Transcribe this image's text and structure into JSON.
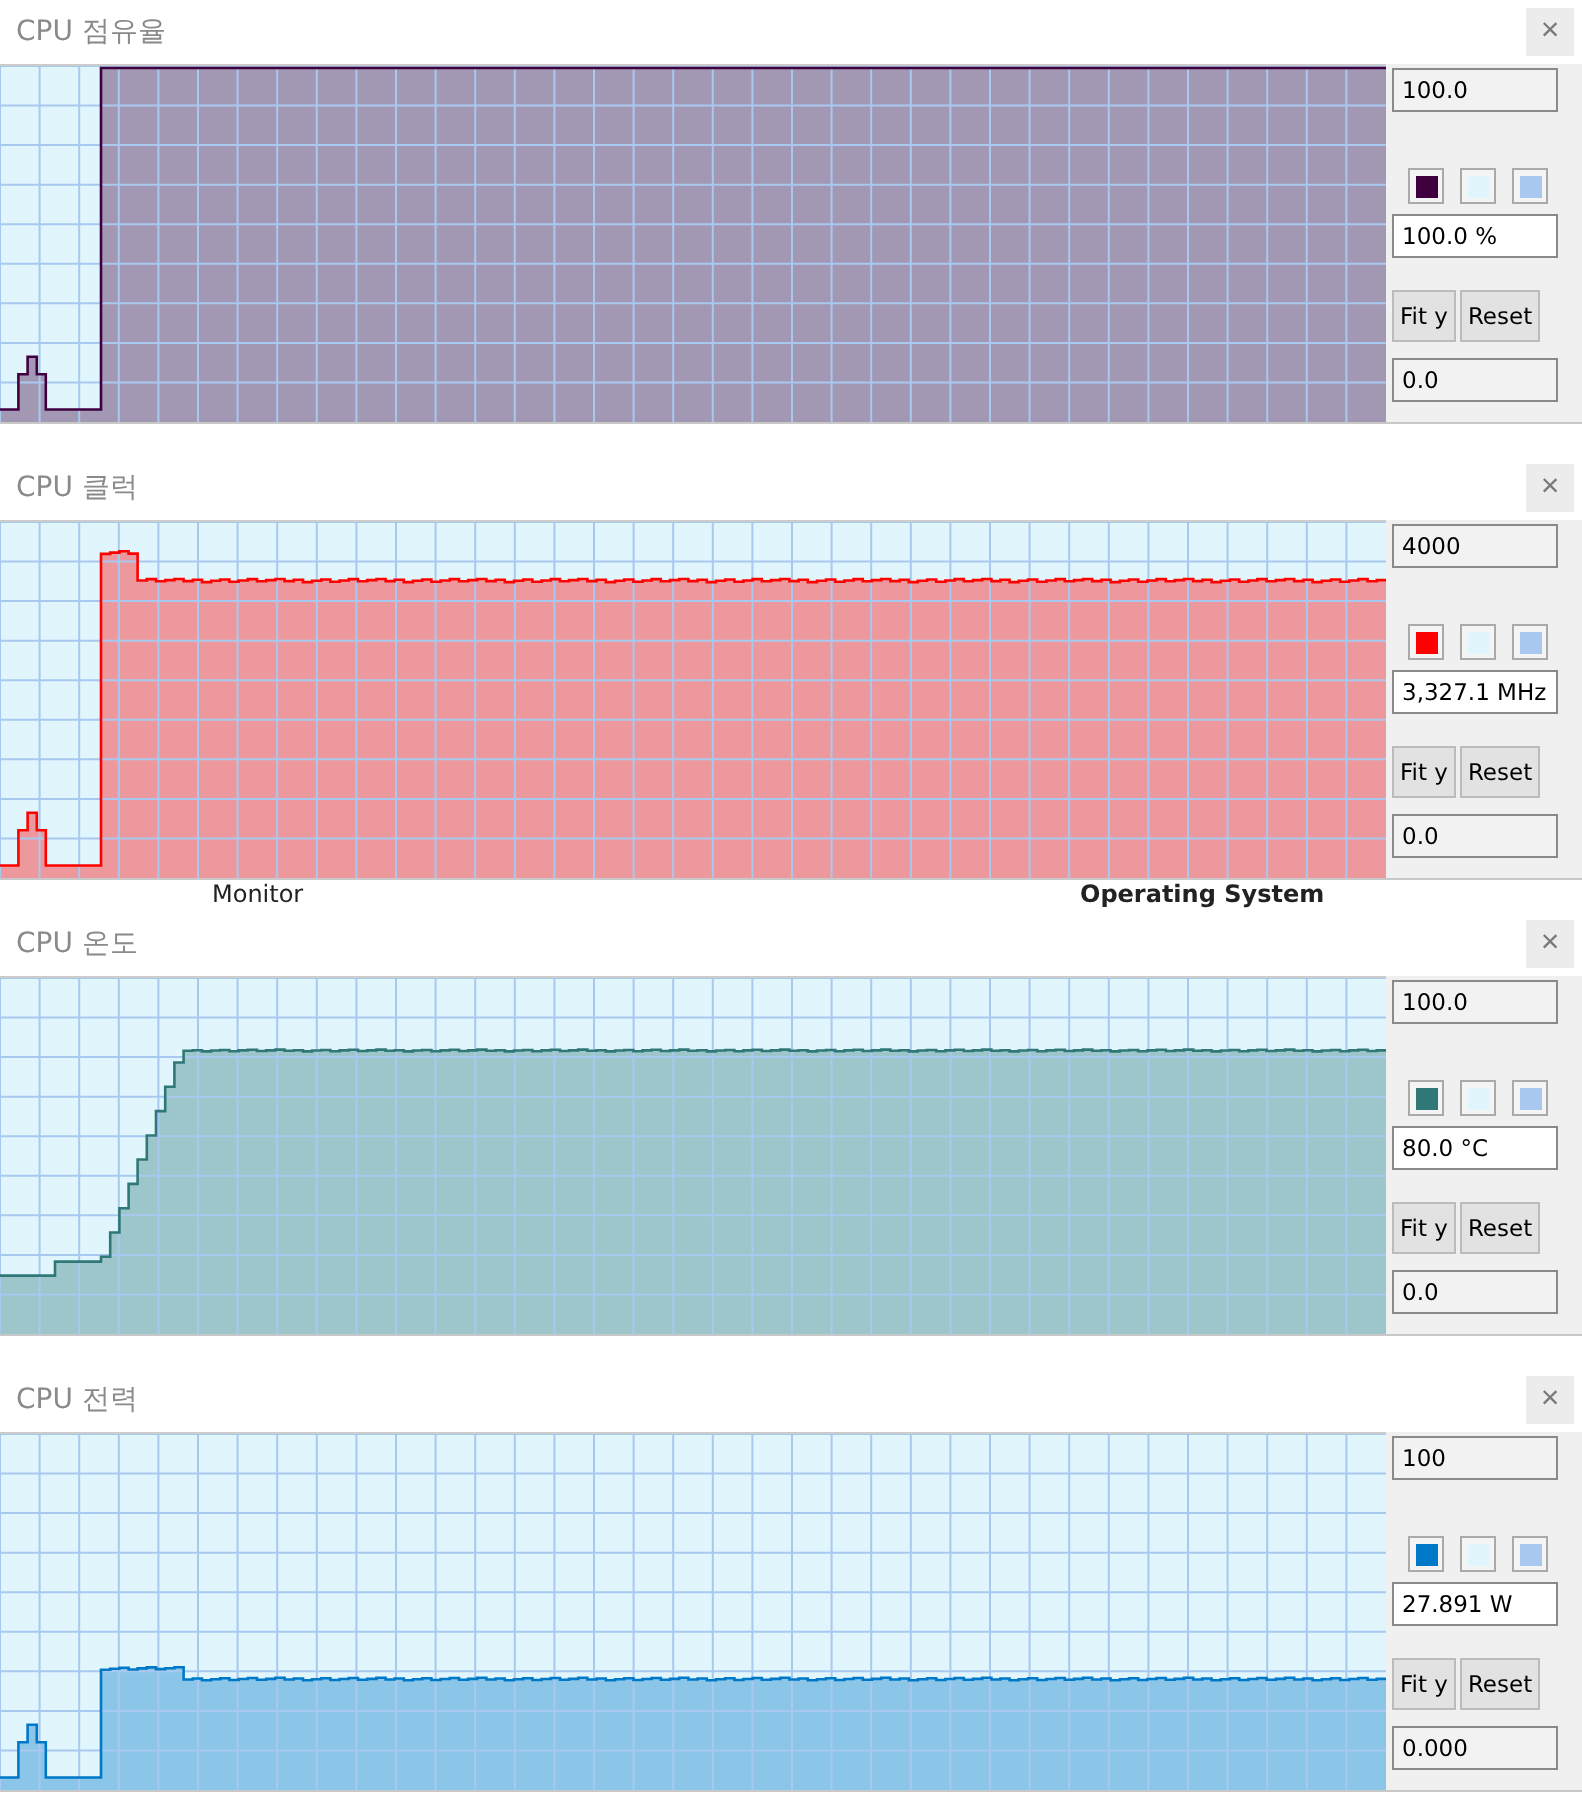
{
  "windows": [
    {
      "title": "CPU 점유율",
      "close": "×",
      "max": "100.0",
      "current": "100.0 %",
      "min": "0.0",
      "buttons": [
        "Fit y",
        "Reset"
      ],
      "swatches": [
        {
          "color": "#400040"
        },
        {
          "color": "#e0f6fc"
        },
        {
          "color": "#a8c8f0"
        }
      ]
    },
    {
      "title": "CPU 클럭",
      "close": "×",
      "max": "4000",
      "current": "3,327.1 MHz",
      "min": "0.0",
      "buttons": [
        "Fit y",
        "Reset"
      ],
      "swatches": [
        {
          "color": "#ff0000"
        },
        {
          "color": "#e0f6fc"
        },
        {
          "color": "#a8c8f0"
        }
      ],
      "behind_texts": [
        "Monitor",
        "Operating System"
      ]
    },
    {
      "title": "CPU 온도",
      "close": "×",
      "max": "100.0",
      "current": "80.0 °C",
      "min": "0.0",
      "buttons": [
        "Fit y",
        "Reset"
      ],
      "swatches": [
        {
          "color": "#307878"
        },
        {
          "color": "#e0f6fc"
        },
        {
          "color": "#a8c8f0"
        }
      ]
    },
    {
      "title": "CPU 전력",
      "close": "×",
      "max": "100",
      "current": "27.891 W",
      "min": "0.000",
      "buttons": [
        "Fit y",
        "Reset"
      ],
      "swatches": [
        {
          "color": "#0078c8"
        },
        {
          "color": "#e0f6fc"
        },
        {
          "color": "#a8c8f0"
        }
      ]
    }
  ]
}
